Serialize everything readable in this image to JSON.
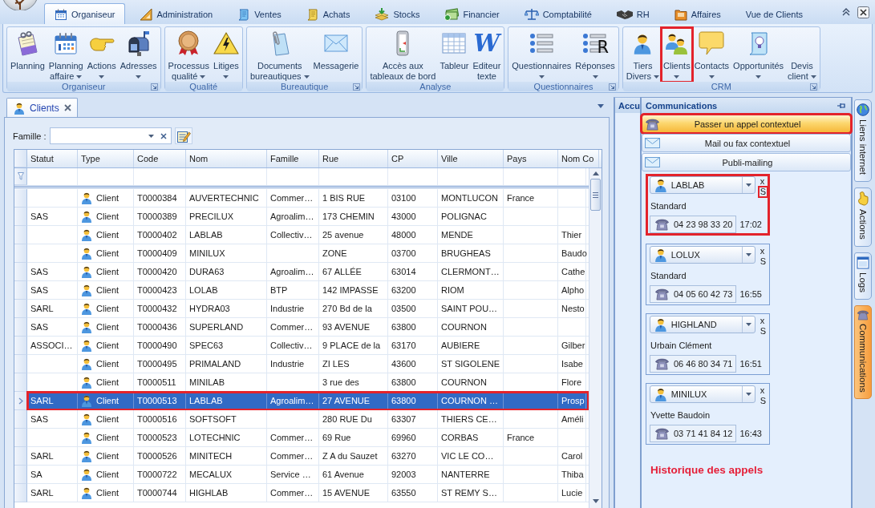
{
  "ribbon": {
    "tabs": [
      {
        "label": "Organiseur",
        "selected": true
      },
      {
        "label": "Administration",
        "selected": false
      },
      {
        "label": "Ventes",
        "selected": false
      },
      {
        "label": "Achats",
        "selected": false
      },
      {
        "label": "Stocks",
        "selected": false
      },
      {
        "label": "Financier",
        "selected": false
      },
      {
        "label": "Comptabilité",
        "selected": false
      },
      {
        "label": "RH",
        "selected": false
      },
      {
        "label": "Affaires",
        "selected": false
      },
      {
        "label": "Vue de Clients",
        "selected": false
      }
    ],
    "groups": [
      {
        "label": "Organiseur",
        "launcher": true,
        "buttons": [
          {
            "lines": [
              "Planning"
            ],
            "menu": false,
            "annotated": false
          },
          {
            "lines": [
              "Planning",
              "affaire"
            ],
            "menu": true,
            "annotated": false
          },
          {
            "lines": [
              "Actions"
            ],
            "menu": true,
            "annotated": false
          },
          {
            "lines": [
              "Adresses"
            ],
            "menu": true,
            "annotated": false
          }
        ]
      },
      {
        "label": "Qualité",
        "launcher": false,
        "buttons": [
          {
            "lines": [
              "Processus",
              "qualité"
            ],
            "menu": true,
            "annotated": false
          },
          {
            "lines": [
              "Litiges"
            ],
            "menu": true,
            "annotated": false
          }
        ]
      },
      {
        "label": "Bureautique",
        "launcher": true,
        "buttons": [
          {
            "lines": [
              "Documents",
              "bureautiques"
            ],
            "menu": true,
            "annotated": false
          },
          {
            "lines": [
              "Messagerie"
            ],
            "menu": false,
            "annotated": false
          }
        ]
      },
      {
        "label": "Analyse",
        "launcher": false,
        "buttons": [
          {
            "lines": [
              "Accès aux",
              "tableaux de bord"
            ],
            "menu": false,
            "annotated": false
          },
          {
            "lines": [
              "Tableur"
            ],
            "menu": false,
            "annotated": false
          },
          {
            "lines": [
              "Editeur",
              "texte"
            ],
            "menu": false,
            "annotated": false,
            "icon_letter": "W"
          }
        ]
      },
      {
        "label": "Questionnaires",
        "launcher": true,
        "buttons": [
          {
            "lines": [
              "Questionnaires"
            ],
            "menu": true,
            "annotated": false
          },
          {
            "lines": [
              "Réponses"
            ],
            "menu": true,
            "annotated": false,
            "icon_letter": "R"
          }
        ]
      },
      {
        "label": "CRM",
        "launcher": true,
        "buttons": [
          {
            "lines": [
              "Tiers",
              "Divers"
            ],
            "menu": true,
            "annotated": false
          },
          {
            "lines": [
              "Clients"
            ],
            "menu": true,
            "annotated": true
          },
          {
            "lines": [
              "Contacts"
            ],
            "menu": true,
            "annotated": false
          },
          {
            "lines": [
              "Opportunités"
            ],
            "menu": true,
            "annotated": false
          },
          {
            "lines": [
              "Devis",
              "client"
            ],
            "menu": true,
            "annotated": false
          }
        ]
      }
    ]
  },
  "document": {
    "tab": {
      "label": "Clients",
      "selected": true
    },
    "filter": {
      "label": "Famille :"
    },
    "grid": {
      "columns": [
        {
          "label": "Statut",
          "kind": "text"
        },
        {
          "label": "Type",
          "kind": "icon_text"
        },
        {
          "label": "Code",
          "kind": "text"
        },
        {
          "label": "Nom",
          "kind": "text"
        },
        {
          "label": "Famille",
          "kind": "text"
        },
        {
          "label": "Rue",
          "kind": "text"
        },
        {
          "label": "CP",
          "kind": "text"
        },
        {
          "label": "Ville",
          "kind": "text"
        },
        {
          "label": "Pays",
          "kind": "text"
        },
        {
          "label": "Nom Co",
          "kind": "text"
        }
      ],
      "rows": [
        {
          "cells": [
            null,
            "Client",
            "T0000384",
            "AUVERTECHNIC",
            "Commer…",
            "1 BIS RUE",
            "03100",
            "MONTLUCON",
            "France",
            null
          ],
          "selected": false,
          "annotated": false
        },
        {
          "cells": [
            "SAS",
            "Client",
            "T0000389",
            "PRECILUX",
            "Agroalim…",
            "173 CHEMIN",
            "43000",
            "POLIGNAC",
            null,
            null
          ],
          "selected": false,
          "annotated": false
        },
        {
          "cells": [
            null,
            "Client",
            "T0000402",
            "LABLAB",
            "Collectiv…",
            "25 avenue",
            "48000",
            "MENDE",
            null,
            "Thier"
          ],
          "selected": false,
          "annotated": false
        },
        {
          "cells": [
            null,
            "Client",
            "T0000409",
            "MINILUX",
            null,
            "ZONE",
            "03700",
            "BRUGHEAS",
            null,
            "Baudo"
          ],
          "selected": false,
          "annotated": false
        },
        {
          "cells": [
            "SAS",
            "Client",
            "T0000420",
            "DURA63",
            "Agroalim…",
            "67 ALLÉE",
            "63014",
            "CLERMONT…",
            null,
            "Cathe"
          ],
          "selected": false,
          "annotated": false
        },
        {
          "cells": [
            "SAS",
            "Client",
            "T0000423",
            "LOLAB",
            "BTP",
            "142 IMPASSE",
            "63200",
            "RIOM",
            null,
            "Alpho"
          ],
          "selected": false,
          "annotated": false
        },
        {
          "cells": [
            "SARL",
            "Client",
            "T0000432",
            "HYDRA03",
            "Industrie",
            "270 Bd de la",
            "03500",
            "SAINT POU…",
            null,
            "Nesto"
          ],
          "selected": false,
          "annotated": false
        },
        {
          "cells": [
            "SAS",
            "Client",
            "T0000436",
            "SUPERLAND",
            "Commer…",
            "93 AVENUE",
            "63800",
            "COURNON",
            null,
            null
          ],
          "selected": false,
          "annotated": false
        },
        {
          "cells": [
            "ASSOCI…",
            "Client",
            "T0000490",
            "SPEC63",
            "Collectiv…",
            "9 PLACE de la",
            "63170",
            "AUBIERE",
            null,
            "Gilber"
          ],
          "selected": false,
          "annotated": false
        },
        {
          "cells": [
            null,
            "Client",
            "T0000495",
            "PRIMALAND",
            "Industrie",
            "ZI LES",
            "43600",
            "ST SIGOLENE",
            null,
            "Isabe"
          ],
          "selected": false,
          "annotated": false
        },
        {
          "cells": [
            null,
            "Client",
            "T0000511",
            "MINILAB",
            null,
            "3 rue des",
            "63800",
            "COURNON",
            null,
            "Flore"
          ],
          "selected": false,
          "annotated": false
        },
        {
          "cells": [
            "SARL",
            "Client",
            "T0000513",
            "LABLAB",
            "Agroalim…",
            "27 AVENUE",
            "63800",
            "COURNON …",
            null,
            "Prosp"
          ],
          "selected": true,
          "annotated": true
        },
        {
          "cells": [
            "SAS",
            "Client",
            "T0000516",
            "SOFTSOFT",
            null,
            "280 RUE Du",
            "63307",
            "THIERS CE…",
            null,
            "Améli"
          ],
          "selected": false,
          "annotated": false
        },
        {
          "cells": [
            null,
            "Client",
            "T0000523",
            "LOTECHNIC",
            "Commer…",
            "69 Rue",
            "69960",
            "CORBAS",
            "France",
            null
          ],
          "selected": false,
          "annotated": false
        },
        {
          "cells": [
            "SARL",
            "Client",
            "T0000526",
            "MINITECH",
            "Commer…",
            "Z A du Sauzet",
            "63270",
            "VIC LE CO…",
            null,
            "Carol"
          ],
          "selected": false,
          "annotated": false
        },
        {
          "cells": [
            "SA",
            "Client",
            "T0000722",
            "MECALUX",
            "Service …",
            "61 Avenue",
            "92003",
            "NANTERRE",
            null,
            "Thiba"
          ],
          "selected": false,
          "annotated": false
        },
        {
          "cells": [
            "SARL",
            "Client",
            "T0000744",
            "HIGHLAB",
            "Commer…",
            "15 AVENUE",
            "63550",
            "ST REMY S…",
            null,
            "Lucie"
          ],
          "selected": false,
          "annotated": false
        }
      ]
    }
  },
  "hidden_panel": {
    "title": "Accu"
  },
  "communications": {
    "title": "Communications",
    "actions": [
      {
        "label": "Passer un appel contextuel",
        "kind": "phone",
        "highlighted": true,
        "annotated": true
      },
      {
        "label": "Mail ou fax contextuel",
        "kind": "mail",
        "highlighted": false,
        "annotated": false
      },
      {
        "label": "Publi-mailing",
        "kind": "mail",
        "highlighted": false,
        "annotated": false
      }
    ],
    "calls": [
      {
        "contact": "LABLAB",
        "close": "x",
        "letter": "S",
        "letter_annotated": true,
        "annotated": true,
        "name": "Standard",
        "number": "04 23 98 33 20",
        "time": "17:02"
      },
      {
        "contact": "LOLUX",
        "close": "x",
        "letter": "S",
        "letter_annotated": false,
        "annotated": false,
        "name": "Standard",
        "number": "04 05 60 42 73",
        "time": "16:55"
      },
      {
        "contact": "HIGHLAND",
        "close": "x",
        "letter": "S",
        "letter_annotated": false,
        "annotated": false,
        "name": "Urbain Clément",
        "number": "06 46 80 34 71",
        "time": "16:51"
      },
      {
        "contact": "MINILUX",
        "close": "x",
        "letter": "S",
        "letter_annotated": false,
        "annotated": false,
        "name": "Yvette Baudoin",
        "number": "03 71 41 84 12",
        "time": "16:43"
      }
    ],
    "annotation": "Historique des appels"
  },
  "side_tabs": [
    {
      "label": "Liens internet",
      "selected": false
    },
    {
      "label": "Actions",
      "selected": false
    },
    {
      "label": "Logs",
      "selected": false
    },
    {
      "label": "Communications",
      "selected": true
    }
  ]
}
